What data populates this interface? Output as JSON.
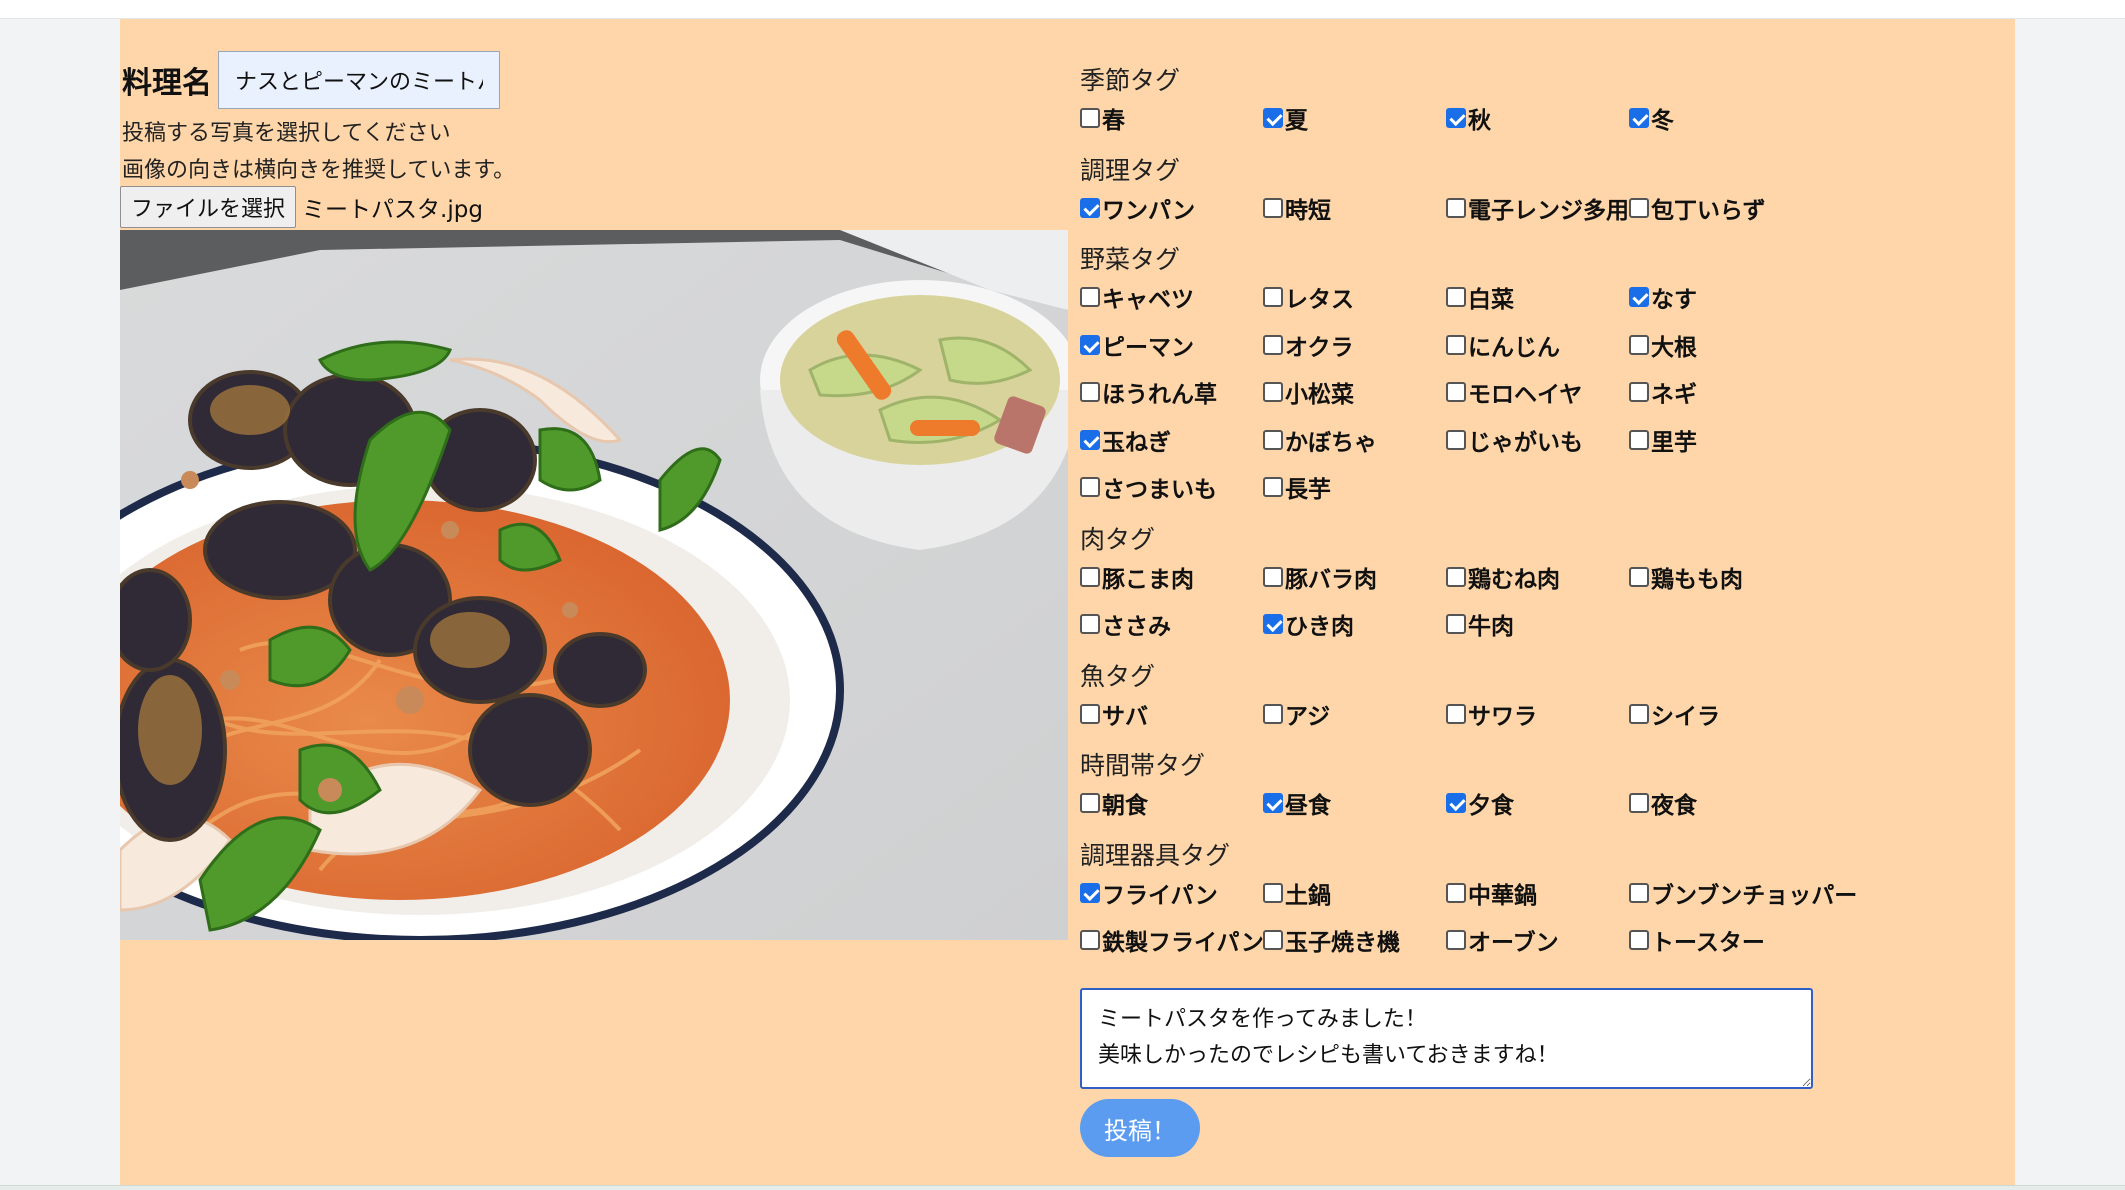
{
  "form": {
    "title_label": "料理名",
    "title_value": "ナスとピーマンのミートパスタ",
    "photo_help_1": "投稿する写真を選択してください",
    "photo_help_2": "画像の向きは横向きを推奨しています。",
    "file_button_label": "ファイルを選択",
    "file_name": "ミートパスタ.jpg",
    "comment": "ミートパスタを作ってみました！\n美味しかったのでレシピも書いておきますね！",
    "submit_label": "投稿！"
  },
  "tag_sections": [
    {
      "key": "season",
      "title": "季節タグ",
      "items": [
        {
          "label": "春",
          "checked": false
        },
        {
          "label": "夏",
          "checked": true
        },
        {
          "label": "秋",
          "checked": true
        },
        {
          "label": "冬",
          "checked": true
        }
      ]
    },
    {
      "key": "cooking",
      "title": "調理タグ",
      "items": [
        {
          "label": "ワンパン",
          "checked": true
        },
        {
          "label": "時短",
          "checked": false
        },
        {
          "label": "電子レンジ多用",
          "checked": false
        },
        {
          "label": "包丁いらず",
          "checked": false
        }
      ]
    },
    {
      "key": "vegetable",
      "title": "野菜タグ",
      "items": [
        {
          "label": "キャベツ",
          "checked": false
        },
        {
          "label": "レタス",
          "checked": false
        },
        {
          "label": "白菜",
          "checked": false
        },
        {
          "label": "なす",
          "checked": true
        },
        {
          "label": "ピーマン",
          "checked": true
        },
        {
          "label": "オクラ",
          "checked": false
        },
        {
          "label": "にんじん",
          "checked": false
        },
        {
          "label": "大根",
          "checked": false
        },
        {
          "label": "ほうれん草",
          "checked": false
        },
        {
          "label": "小松菜",
          "checked": false
        },
        {
          "label": "モロヘイヤ",
          "checked": false
        },
        {
          "label": "ネギ",
          "checked": false
        },
        {
          "label": "玉ねぎ",
          "checked": true
        },
        {
          "label": "かぼちゃ",
          "checked": false
        },
        {
          "label": "じゃがいも",
          "checked": false
        },
        {
          "label": "里芋",
          "checked": false
        },
        {
          "label": "さつまいも",
          "checked": false
        },
        {
          "label": "長芋",
          "checked": false
        }
      ]
    },
    {
      "key": "meat",
      "title": "肉タグ",
      "items": [
        {
          "label": "豚こま肉",
          "checked": false
        },
        {
          "label": "豚バラ肉",
          "checked": false
        },
        {
          "label": "鶏むね肉",
          "checked": false
        },
        {
          "label": "鶏もも肉",
          "checked": false
        },
        {
          "label": "ささみ",
          "checked": false
        },
        {
          "label": "ひき肉",
          "checked": true
        },
        {
          "label": "牛肉",
          "checked": false
        }
      ]
    },
    {
      "key": "fish",
      "title": "魚タグ",
      "items": [
        {
          "label": "サバ",
          "checked": false
        },
        {
          "label": "アジ",
          "checked": false
        },
        {
          "label": "サワラ",
          "checked": false
        },
        {
          "label": "シイラ",
          "checked": false
        }
      ]
    },
    {
      "key": "time",
      "title": "時間帯タグ",
      "items": [
        {
          "label": "朝食",
          "checked": false
        },
        {
          "label": "昼食",
          "checked": true
        },
        {
          "label": "夕食",
          "checked": true
        },
        {
          "label": "夜食",
          "checked": false
        }
      ]
    },
    {
      "key": "utensil",
      "title": "調理器具タグ",
      "items": [
        {
          "label": "フライパン",
          "checked": true
        },
        {
          "label": "土鍋",
          "checked": false
        },
        {
          "label": "中華鍋",
          "checked": false
        },
        {
          "label": "ブンブンチョッパー",
          "checked": false
        },
        {
          "label": "鉄製フライパン",
          "checked": false
        },
        {
          "label": "玉子焼き機",
          "checked": false
        },
        {
          "label": "オーブン",
          "checked": false
        },
        {
          "label": "トースター",
          "checked": false
        }
      ]
    }
  ],
  "colors": {
    "panel": "#fed6a9",
    "checkbox_on": "#1a6ee8",
    "submit_button": "#5b9cf0"
  },
  "photo_icon": "food-photo-meat-pasta"
}
